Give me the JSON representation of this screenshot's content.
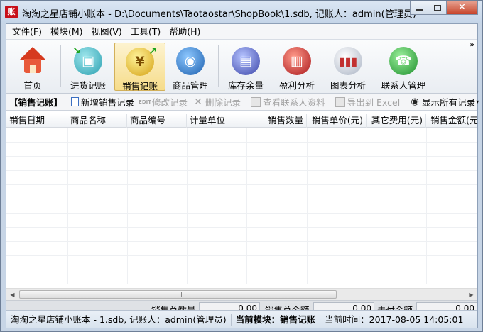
{
  "window": {
    "app_icon_text": "账",
    "title": "淘淘之星店铺小账本 - D:\\Documents\\Taotaostar\\ShopBook\\1.sdb,  记账人：admin(管理员)"
  },
  "menu": [
    "文件(F)",
    "模块(M)",
    "视图(V)",
    "工具(T)",
    "帮助(H)"
  ],
  "toolbar": {
    "items": [
      {
        "label": "首页",
        "icon": "home-icon"
      },
      {
        "label": "进货记账",
        "icon": "purchase-box-icon"
      },
      {
        "label": "销售记账",
        "icon": "sales-yuan-icon",
        "active": true
      },
      {
        "label": "商品管理",
        "icon": "goods-globe-icon"
      },
      {
        "label": "库存余量",
        "icon": "inventory-cylinder-icon"
      },
      {
        "label": "盈利分析",
        "icon": "profit-analysis-icon"
      },
      {
        "label": "图表分析",
        "icon": "bar-chart-icon"
      },
      {
        "label": "联系人管理",
        "icon": "phone-contacts-icon"
      }
    ],
    "more": "»"
  },
  "subbar": {
    "title": "【销售记账】",
    "buttons": [
      {
        "label": "新增销售记录",
        "icon": "new-document-icon",
        "enabled": true
      },
      {
        "label": "修改记录",
        "icon": "edit-icon",
        "enabled": false
      },
      {
        "label": "删除记录",
        "icon": "delete-x-icon",
        "enabled": false
      },
      {
        "label": "查看联系人资料",
        "icon": "contact-card-icon",
        "enabled": false
      },
      {
        "label": "导出到 Excel",
        "icon": "export-icon",
        "enabled": false
      },
      {
        "label": "显示所有记录",
        "icon": "eye-icon",
        "enabled": true
      }
    ],
    "edit_icon_text": "EDIT"
  },
  "grid": {
    "columns": [
      "销售日期",
      "商品名称",
      "商品编号",
      "计量单位",
      "销售数量",
      "销售单价(元)",
      "其它费用(元)",
      "销售金额(元)"
    ],
    "rows": []
  },
  "scrollbar": {
    "left_arrow": "◀",
    "right_arrow": "▶"
  },
  "totals": {
    "qty_label": "销售总数量",
    "qty_value": "0.00",
    "amount_label": "销售总金额",
    "amount_value": "0.00",
    "unpaid_label": "未付金额",
    "unpaid_value": "0.00"
  },
  "status": {
    "app": "淘淘之星店铺小账本 - 1.sdb,  记账人：admin(管理员)",
    "module": "当前模块：销售记账",
    "time": "当前时间：2017-08-05 14:05:01"
  },
  "colors": {
    "active_tool": "#f6dc8a",
    "title_bar": "#c5d5e8",
    "close_button": "#c7442b"
  }
}
